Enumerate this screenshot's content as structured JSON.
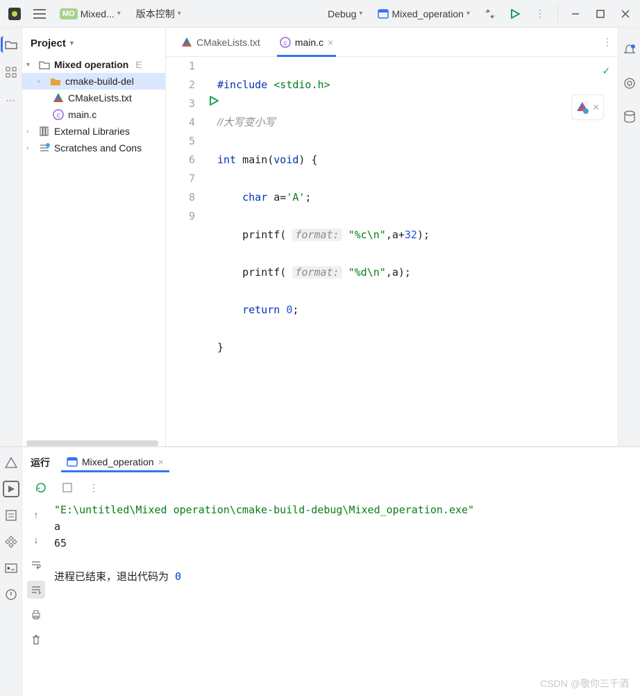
{
  "topbar": {
    "project_badge": "MO",
    "project_name": "Mixed...",
    "vcs_label": "版本控制",
    "config_label": "Debug",
    "run_target": "Mixed_operation"
  },
  "sidebar": {
    "title": "Project",
    "nodes": [
      {
        "label": "Mixed operation",
        "hint": "E",
        "level": 0,
        "expand": true,
        "icon": "folder"
      },
      {
        "label": "cmake-build-del",
        "level": 1,
        "expand": false,
        "icon": "folder-orange",
        "sel": true
      },
      {
        "label": "CMakeLists.txt",
        "level": 1,
        "expand": null,
        "icon": "cmake"
      },
      {
        "label": "main.c",
        "level": 1,
        "expand": null,
        "icon": "cfile"
      },
      {
        "label": "External Libraries",
        "level": 0,
        "expand": false,
        "icon": "lib"
      },
      {
        "label": "Scratches and Cons",
        "level": 0,
        "expand": false,
        "icon": "scratch"
      }
    ]
  },
  "tabs": [
    {
      "label": "CMakeLists.txt",
      "icon": "cmake",
      "active": false
    },
    {
      "label": "main.c",
      "icon": "cfile",
      "active": true
    }
  ],
  "gutter": [
    "1",
    "2",
    "3",
    "4",
    "5",
    "6",
    "7",
    "8",
    "9"
  ],
  "code": {
    "l1_pre": "#include ",
    "l1_hdr": "<stdio.h>",
    "l2": "//大写变小写",
    "l3_int": "int",
    "l3_fn": " main(",
    "l3_void": "void",
    "l3_rest": ") {",
    "l4_char": "char",
    "l4_rest": " a=",
    "l4_str": "'A'",
    "l4_end": ";",
    "l5_pre": "    printf( ",
    "l5_hint": "format:",
    "l5_fmt": " \"%c\\n\"",
    "l5_rest": ",a+",
    "l5_num": "32",
    "l5_end": ");",
    "l6_pre": "    printf( ",
    "l6_hint": "format:",
    "l6_fmt": " \"%d\\n\"",
    "l6_rest": ",a);",
    "l7_ret": "return",
    "l7_sp": " ",
    "l7_num": "0",
    "l7_end": ";",
    "l8": "}",
    "l9": ""
  },
  "run": {
    "tab_title": "运行",
    "tab_name": "Mixed_operation",
    "console": {
      "path": "\"E:\\untitled\\Mixed operation\\cmake-build-debug\\Mixed_operation.exe\"",
      "out1": "a",
      "out2": "65",
      "exit_prefix": "进程已结束，退出代码为 ",
      "exit_code": "0"
    }
  },
  "watermark": "CSDN @敬你三千酒"
}
